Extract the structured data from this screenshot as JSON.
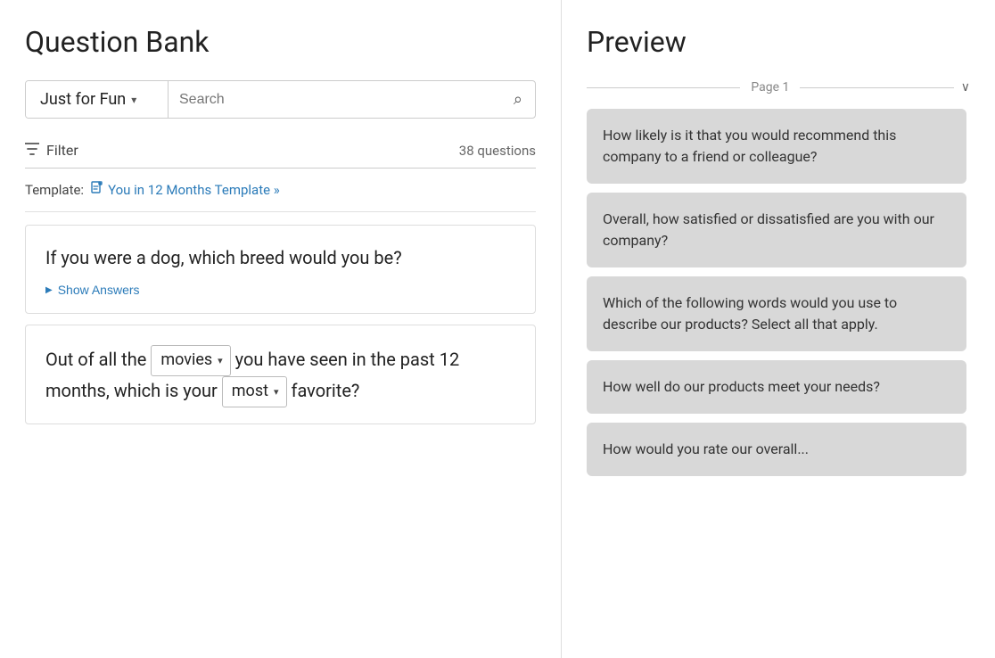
{
  "left": {
    "title": "Question Bank",
    "category": {
      "label": "Just for Fun",
      "dropdown_arrow": "▾"
    },
    "search": {
      "placeholder": "Search"
    },
    "filter": {
      "label": "Filter",
      "count": "38 questions"
    },
    "template": {
      "prefix": "Template:",
      "link_text": "You in 12 Months Template »"
    },
    "questions": [
      {
        "id": "q1",
        "text": "If you were a dog, which breed would you be?",
        "type": "simple",
        "show_answers_label": "Show Answers"
      },
      {
        "id": "q2",
        "type": "inline",
        "parts": [
          "Out of all the",
          "movies",
          "you have seen in the past 12 months, which is your",
          "most",
          "favorite?"
        ]
      }
    ]
  },
  "right": {
    "title": "Preview",
    "page_label": "Page 1",
    "questions": [
      {
        "text": "How likely is it that you would recommend this company to a friend or colleague?"
      },
      {
        "text": "Overall, how satisfied or dissatisfied are you with our company?"
      },
      {
        "text": "Which of the following words would you use to describe our products? Select all that apply."
      },
      {
        "text": "How well do our products meet your needs?"
      },
      {
        "text": "How would you rate our overall...",
        "partial": true
      }
    ]
  },
  "icons": {
    "search": "🔍",
    "filter": "▼",
    "doc": "📄",
    "chevron_down": "∨",
    "play": "▶"
  }
}
